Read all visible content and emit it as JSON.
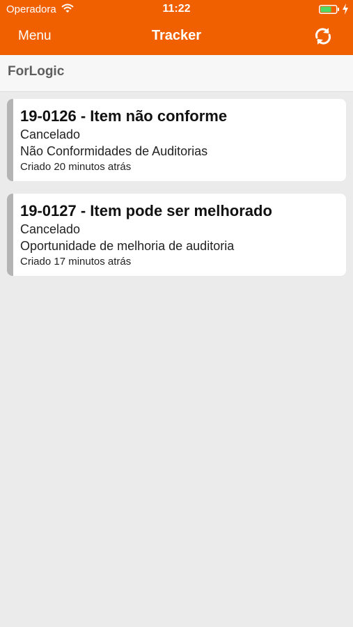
{
  "status_bar": {
    "carrier": "Operadora",
    "time": "11:22"
  },
  "nav_bar": {
    "menu_label": "Menu",
    "title": "Tracker",
    "refresh_icon": "refresh-icon"
  },
  "company": {
    "name": "ForLogic"
  },
  "items": [
    {
      "title": "19-0126 - Item não conforme",
      "status": "Cancelado",
      "category": "Não Conformidades de Auditorias",
      "created": "Criado 20 minutos atrás"
    },
    {
      "title": "19-0127 - Item pode ser melhorado",
      "status": "Cancelado",
      "category": "Oportunidade de melhoria de auditoria",
      "created": "Criado 17 minutos atrás"
    }
  ],
  "colors": {
    "brand": "#f06000",
    "card_accent": "#b4b4b4",
    "background": "#ebebeb",
    "battery_fill": "#4cd964"
  }
}
